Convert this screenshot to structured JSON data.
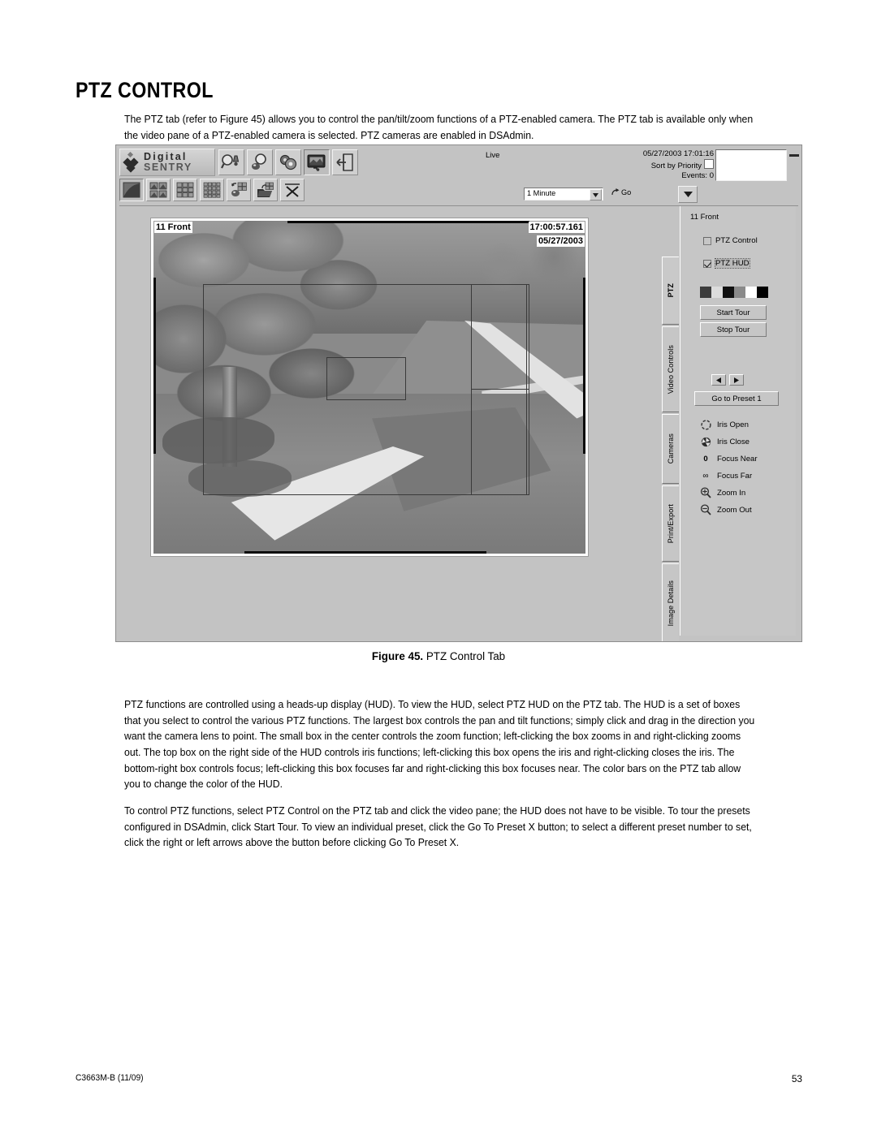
{
  "document": {
    "title": "PTZ CONTROL",
    "intro": "The PTZ tab (refer to Figure 45) allows you to control the pan/tilt/zoom functions of a PTZ-enabled camera. The PTZ tab is available only when the video pane of a PTZ-enabled camera is selected. PTZ cameras are enabled in DSAdmin.",
    "figure_caption_label": "Figure 45.",
    "figure_caption_text": "PTZ Control Tab",
    "paragraph_2": "PTZ functions are controlled using a heads-up display (HUD). To view the HUD, select PTZ HUD on the PTZ tab. The HUD is a set of boxes that you select to control the various PTZ functions. The largest box controls the pan and tilt functions; simply click and drag in the direction you want the camera lens to point. The small box in the center controls the zoom function; left-clicking the box zooms in and right-clicking zooms out. The top box on the right side of the HUD controls iris functions; left-clicking this box opens the iris and right-clicking closes the iris. The bottom-right box controls focus; left-clicking this box focuses far and right-clicking this box focuses near. The color bars on the PTZ tab allow you to change the color of the HUD.",
    "paragraph_3": "To control PTZ functions, select PTZ Control on the PTZ tab and click the video pane; the HUD does not have to be visible. To tour the presets configured in DSAdmin, click Start Tour. To view an individual preset, click the Go To Preset X button; to select a different preset number to set, click the right or left arrows above the button before clicking Go To Preset X.",
    "footer_doc_id": "C3663M-B (11/09)",
    "footer_page": "53"
  },
  "app": {
    "logo": {
      "line1": "Digital",
      "line2": "SENTRY"
    },
    "toolbar_row1": [
      {
        "name": "search-alarm-icon",
        "label": "Search Alarms",
        "active": false
      },
      {
        "name": "search-camera-icon",
        "label": "Search Cameras",
        "active": false
      },
      {
        "name": "settings-gears-icon",
        "label": "Settings",
        "active": false
      },
      {
        "name": "live-monitor-icon",
        "label": "Live Monitor",
        "active": true
      },
      {
        "name": "exit-door-icon",
        "label": "Exit",
        "active": false
      }
    ],
    "toolbar_row2": [
      {
        "name": "layout-1up-icon",
        "label": "1 Pane",
        "active": true
      },
      {
        "name": "layout-2x2-icon",
        "label": "4 Panes",
        "active": false
      },
      {
        "name": "layout-3x3-icon",
        "label": "9 Panes",
        "active": false
      },
      {
        "name": "layout-4x4-icon",
        "label": "16 Panes",
        "active": false
      },
      {
        "name": "save-layout-icon",
        "label": "Save Layout",
        "active": false
      },
      {
        "name": "open-layout-icon",
        "label": "Open Layout",
        "active": false
      },
      {
        "name": "close-layout-icon",
        "label": "Close",
        "active": false
      }
    ],
    "status": {
      "mode": "Live",
      "datetime": "05/27/2003 17:01:16",
      "sort_by_priority_label": "Sort by Priority",
      "sort_by_priority_checked": false,
      "events_label": "Events: 0"
    },
    "interval": {
      "value": "1 Minute",
      "go_label": "Go"
    },
    "video": {
      "camera_name": "11 Front",
      "timestamp": "17:00:57.161",
      "date": "05/27/2003"
    },
    "tabs": [
      {
        "label": "PTZ",
        "active": true
      },
      {
        "label": "Video Controls",
        "active": false
      },
      {
        "label": "Cameras",
        "active": false
      },
      {
        "label": "Print/Export",
        "active": false
      },
      {
        "label": "Image Details",
        "active": false
      }
    ],
    "ptz_panel": {
      "camera_title": "11 Front",
      "ptz_control_label": "PTZ Control",
      "ptz_control_checked": false,
      "ptz_hud_label": "PTZ HUD",
      "ptz_hud_checked": true,
      "hud_colors": [
        "#3c3c3c",
        "#dcdcdc",
        "#101010",
        "#8a8a8a",
        "#ffffff",
        "#000000"
      ],
      "start_tour_label": "Start Tour",
      "stop_tour_label": "Stop Tour",
      "preset_prev_label": "◄",
      "preset_next_label": "►",
      "go_to_preset_label": "Go to Preset 1",
      "commands": [
        {
          "icon": "iris-open-icon",
          "label": "Iris Open"
        },
        {
          "icon": "iris-close-icon",
          "label": "Iris Close"
        },
        {
          "icon": "focus-near-icon",
          "label": "Focus Near",
          "glyph": "0"
        },
        {
          "icon": "focus-far-icon",
          "label": "Focus Far",
          "glyph": "∞"
        },
        {
          "icon": "zoom-in-icon",
          "label": "Zoom In"
        },
        {
          "icon": "zoom-out-icon",
          "label": "Zoom Out"
        }
      ]
    }
  }
}
